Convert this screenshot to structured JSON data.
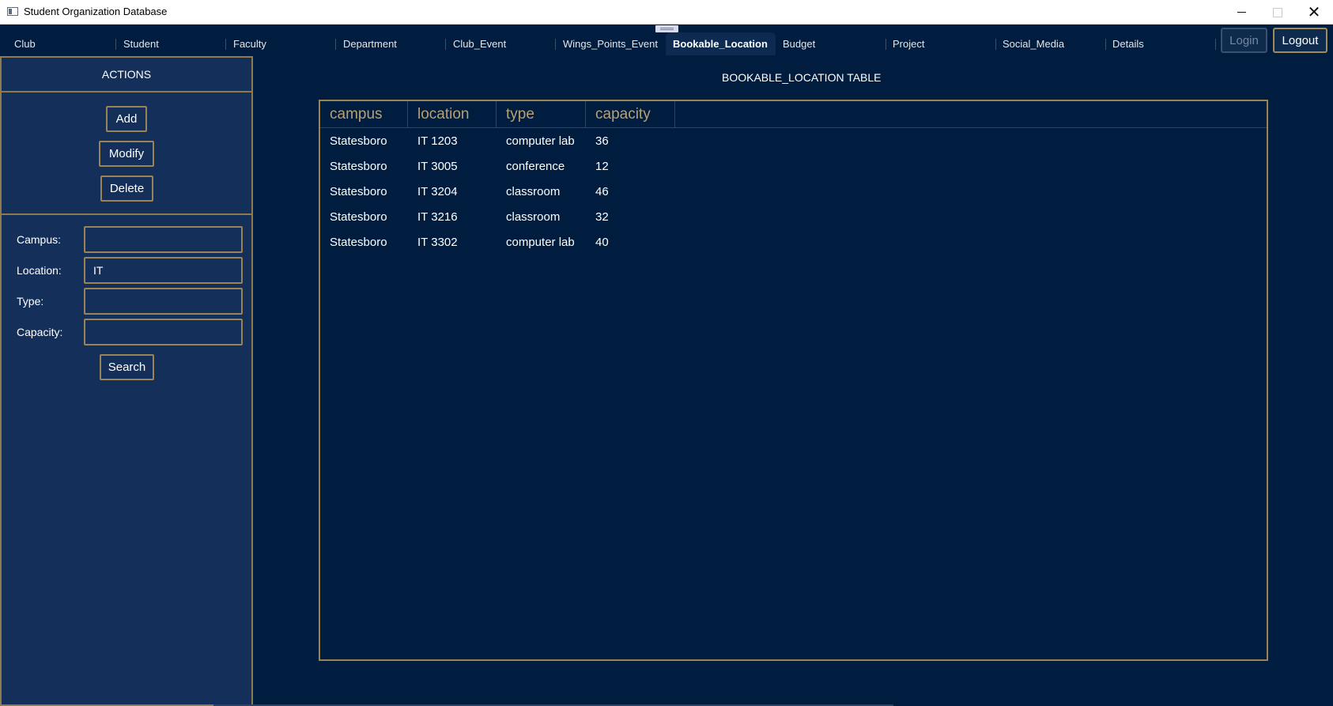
{
  "window": {
    "title": "Student Organization Database"
  },
  "tabs": [
    {
      "label": "Club"
    },
    {
      "label": "Student"
    },
    {
      "label": "Faculty"
    },
    {
      "label": "Department"
    },
    {
      "label": "Club_Event"
    },
    {
      "label": "Wings_Points_Event"
    },
    {
      "label": "Bookable_Location",
      "active": true
    },
    {
      "label": "Budget"
    },
    {
      "label": "Project"
    },
    {
      "label": "Social_Media"
    },
    {
      "label": "Details"
    }
  ],
  "auth": {
    "login_label": "Login",
    "logout_label": "Logout"
  },
  "sidebar": {
    "header": "ACTIONS",
    "add_label": "Add",
    "modify_label": "Modify",
    "delete_label": "Delete",
    "fields": {
      "campus": {
        "label": "Campus:",
        "value": ""
      },
      "location": {
        "label": "Location:",
        "value": "IT"
      },
      "type": {
        "label": "Type:",
        "value": ""
      },
      "capacity": {
        "label": "Capacity:",
        "value": ""
      }
    },
    "search_label": "Search"
  },
  "main": {
    "title": "BOOKABLE_LOCATION TABLE",
    "columns": [
      "campus",
      "location",
      "type",
      "capacity"
    ],
    "rows": [
      [
        "Statesboro",
        "IT 1203",
        "computer lab",
        "36"
      ],
      [
        "Statesboro",
        "IT 3005",
        "conference",
        "12"
      ],
      [
        "Statesboro",
        "IT 3204",
        "classroom",
        "46"
      ],
      [
        "Statesboro",
        "IT 3216",
        "classroom",
        "32"
      ],
      [
        "Statesboro",
        "IT 3302",
        "computer lab",
        "40"
      ]
    ]
  },
  "colors": {
    "background": "#001d3f",
    "sidebar": "#14305a",
    "accent_gold": "#9a8354",
    "header_text": "#b5a175"
  }
}
